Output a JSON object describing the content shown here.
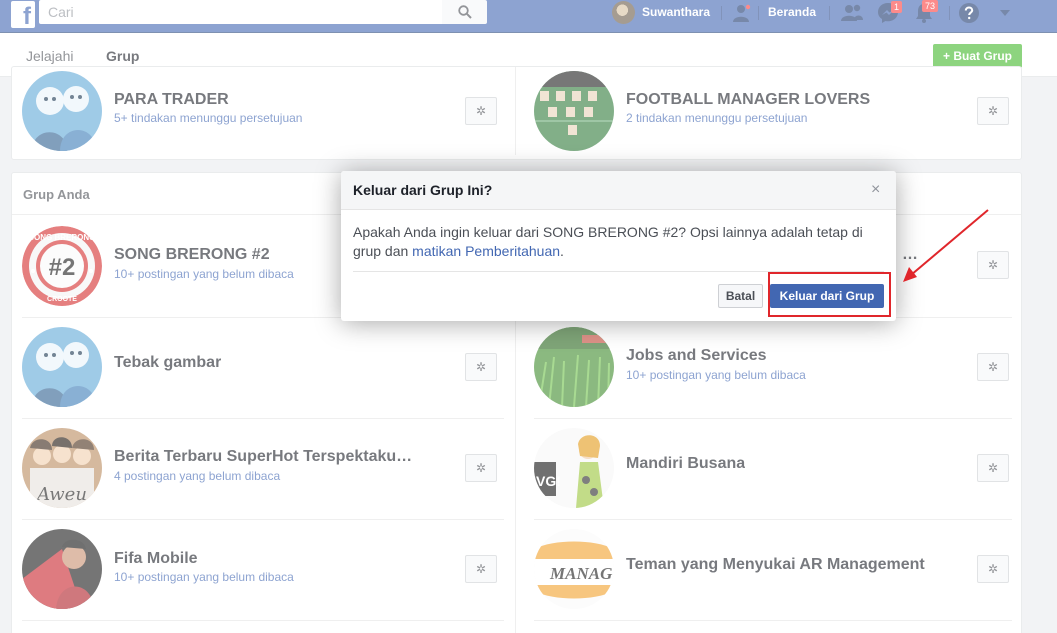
{
  "topbar": {
    "logo": "f",
    "search_placeholder": "Cari",
    "user_name": "Suwanthara",
    "home_label": "Beranda",
    "messages_badge": "1",
    "notifications_badge": "73"
  },
  "subnav": {
    "tabs": [
      {
        "label": "Jelajahi"
      },
      {
        "label": "Grup"
      }
    ],
    "create_group": "+ Buat Grup"
  },
  "managed_groups": [
    {
      "name": "PARA TRADER",
      "sub": "5+ tindakan menunggu persetujuan"
    },
    {
      "name": "FOOTBALL MANAGER LOVERS",
      "sub": "2 tindakan menunggu persetujuan"
    }
  ],
  "your_groups": {
    "title": "Grup Anda",
    "items": [
      {
        "name": "SONG BRERONG #2",
        "sub": "10+ postingan yang belum dibaca"
      },
      {
        "name": "…",
        "sub": ""
      },
      {
        "name": "Tebak gambar",
        "sub": ""
      },
      {
        "name": "Jobs and Services",
        "sub": "10+ postingan yang belum dibaca"
      },
      {
        "name": "Berita Terbaru SuperHot Terspektakuler",
        "sub": "4 postingan yang belum dibaca"
      },
      {
        "name": "Mandiri Busana",
        "sub": ""
      },
      {
        "name": "Fifa Mobile",
        "sub": "10+ postingan yang belum dibaca"
      },
      {
        "name": "Teman yang Menyukai AR Management",
        "sub": ""
      }
    ]
  },
  "avatar_text": {
    "song_brerong_top": "SONG BRERONG",
    "song_brerong_num": "#2",
    "song_brerong_bottom": "CROOTE",
    "berita": "Aweu",
    "mandiri": "VG!",
    "teman": "MANAG"
  },
  "dialog": {
    "title": "Keluar dari Grup Ini?",
    "close": "×",
    "body_text": "Apakah Anda ingin keluar dari SONG BRERONG #2? Opsi lainnya adalah tetap di grup dan ",
    "body_link": "matikan Pemberitahuan",
    "body_end": ".",
    "cancel": "Batal",
    "confirm": "Keluar dari Grup"
  },
  "colors": {
    "brand": "#4267b2",
    "green": "#42b72a",
    "highlight": "#e0262b"
  }
}
